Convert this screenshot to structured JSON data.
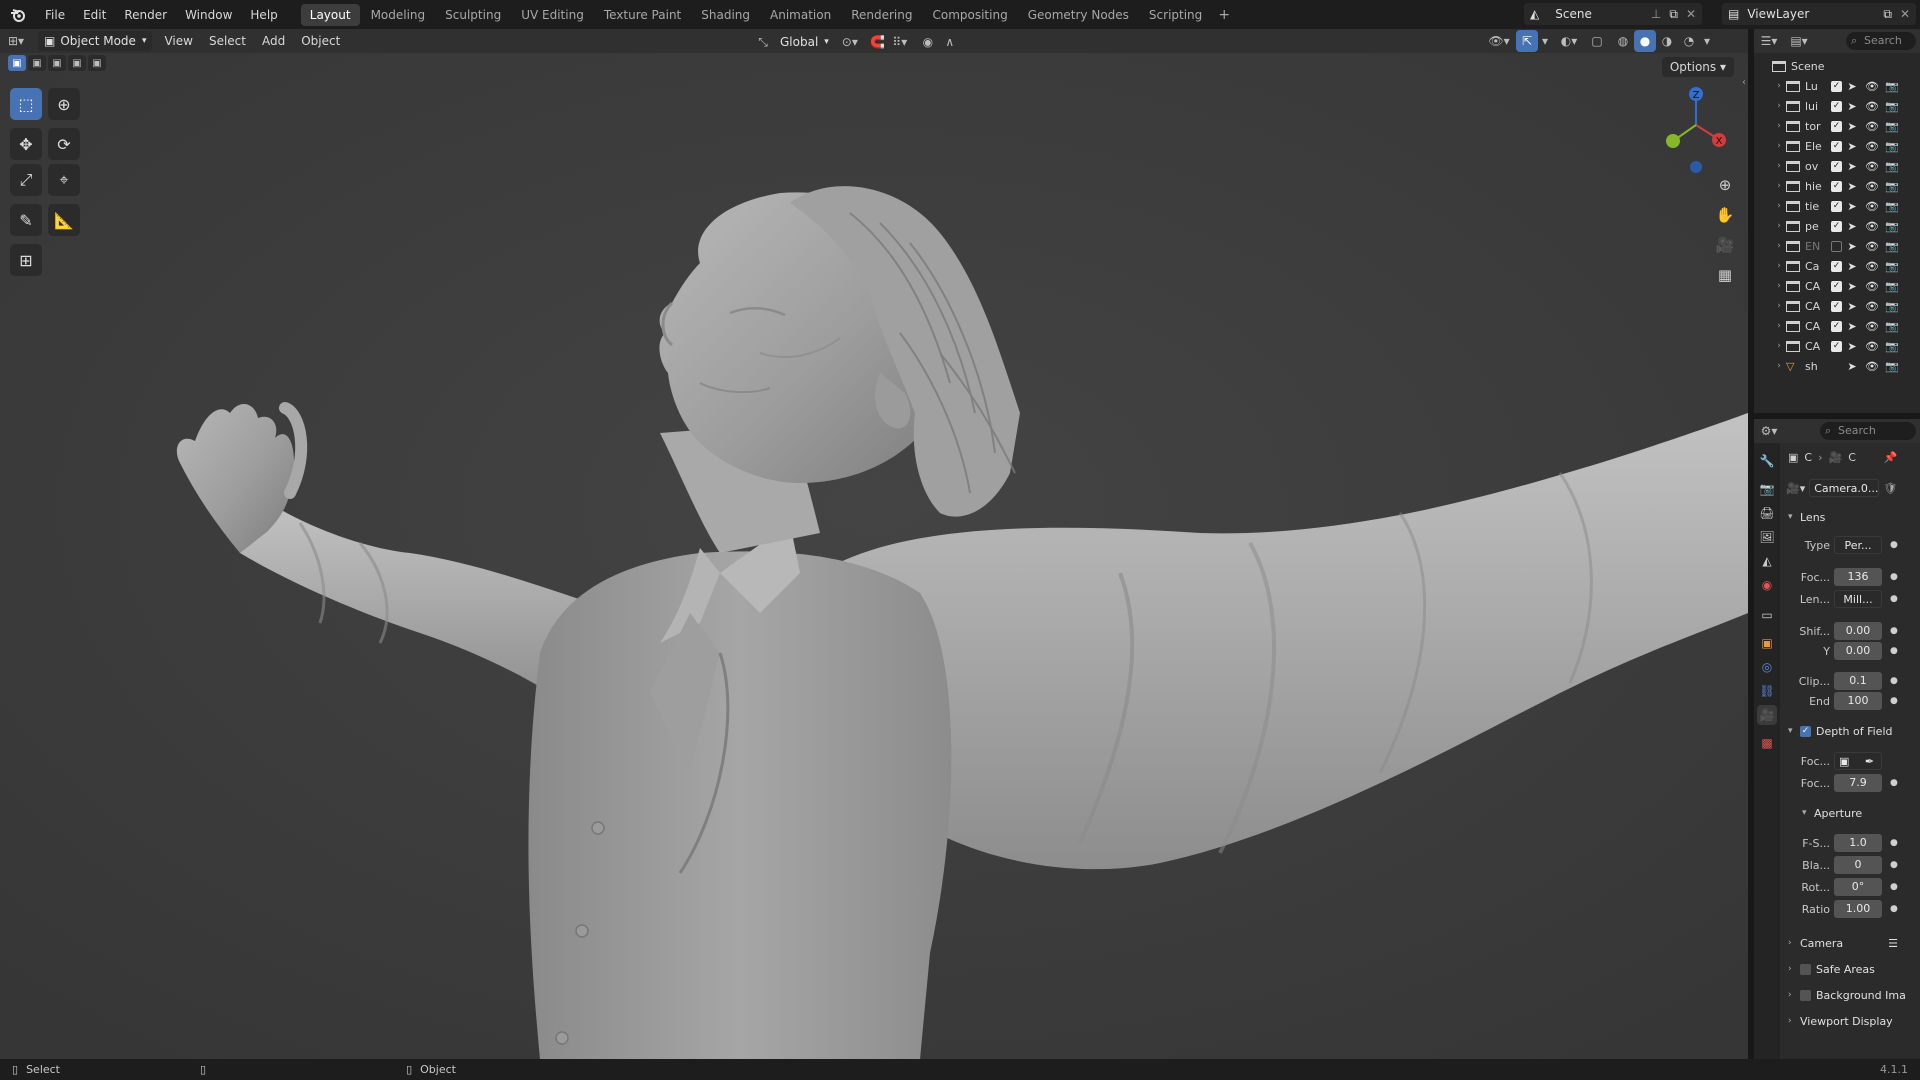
{
  "app": {
    "menu": [
      "File",
      "Edit",
      "Render",
      "Window",
      "Help"
    ],
    "workspaces": [
      "Layout",
      "Modeling",
      "Sculpting",
      "UV Editing",
      "Texture Paint",
      "Shading",
      "Animation",
      "Rendering",
      "Compositing",
      "Geometry Nodes",
      "Scripting"
    ],
    "active_workspace": "Layout",
    "add_tab": "+",
    "scene_name": "Scene",
    "view_layer": "ViewLayer"
  },
  "viewport_header": {
    "mode": "Object Mode",
    "menus": [
      "View",
      "Select",
      "Add",
      "Object"
    ],
    "orientation": "Global",
    "options": "Options"
  },
  "gizmo": {
    "x_label": "X",
    "z_label": "Z"
  },
  "outliner": {
    "search_placeholder": "Search",
    "root": "Scene",
    "items": [
      {
        "name": "Lu",
        "enabled": true
      },
      {
        "name": "lui",
        "enabled": true
      },
      {
        "name": "tor",
        "enabled": true
      },
      {
        "name": "Ele",
        "enabled": true
      },
      {
        "name": "ov",
        "enabled": true
      },
      {
        "name": "hie",
        "enabled": true
      },
      {
        "name": "tie",
        "enabled": true
      },
      {
        "name": "pe",
        "enabled": true
      },
      {
        "name": "EN",
        "enabled": false
      },
      {
        "name": "Ca",
        "enabled": true
      },
      {
        "name": "CA",
        "enabled": true
      },
      {
        "name": "CA",
        "enabled": true
      },
      {
        "name": "CA",
        "enabled": true
      },
      {
        "name": "CA",
        "enabled": true
      },
      {
        "name": "sh",
        "enabled": true
      }
    ]
  },
  "properties": {
    "search_placeholder": "Search",
    "breadcrumb": [
      "C",
      "C"
    ],
    "camera_data": "Camera.0...",
    "lens_section": "Lens",
    "rows": {
      "type": {
        "label": "Type",
        "value": "Per..."
      },
      "focal": {
        "label": "Foc...",
        "value": "136"
      },
      "lens_unit": {
        "label": "Len...",
        "value": "Mill..."
      },
      "shift_x": {
        "label": "Shif...",
        "value": "0.00"
      },
      "shift_y": {
        "label": "Y",
        "value": "0.00"
      },
      "clip_start": {
        "label": "Clip...",
        "value": "0.1"
      },
      "clip_end": {
        "label": "End",
        "value": "100"
      },
      "focus_dist": {
        "label": "Foc...",
        "value": "7.9"
      },
      "focus_obj": {
        "label": "Foc..."
      },
      "fstop": {
        "label": "F-S...",
        "value": "1.0"
      },
      "blades": {
        "label": "Bla...",
        "value": "0"
      },
      "rotation": {
        "label": "Rot...",
        "value": "0°"
      },
      "ratio": {
        "label": "Ratio",
        "value": "1.00"
      }
    },
    "dof_section": "Depth of Field",
    "aperture_section": "Aperture",
    "camera_section": "Camera",
    "safe_areas_section": "Safe Areas",
    "background_section": "Background Ima",
    "viewport_display_section": "Viewport Display"
  },
  "statusbar": {
    "select": "Select",
    "object": "Object",
    "version": "4.1.1"
  }
}
